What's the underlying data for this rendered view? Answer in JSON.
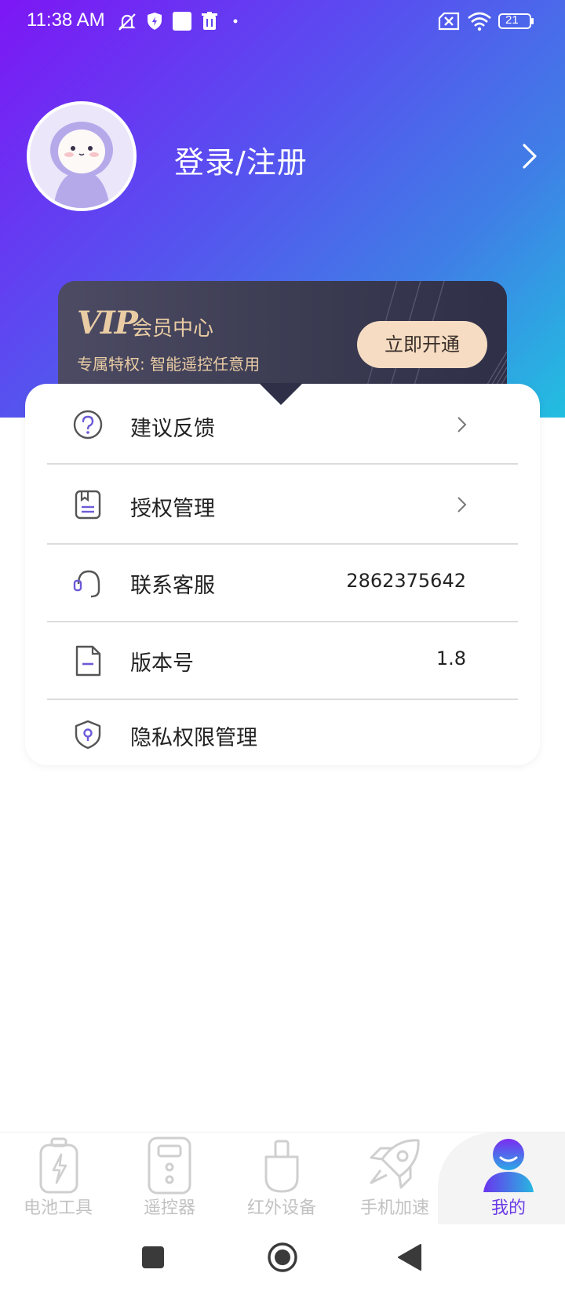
{
  "status_bar": {
    "time": "11:38 AM",
    "battery_level": "21"
  },
  "profile": {
    "login_label": "登录/注册"
  },
  "vip": {
    "logo": "VIP",
    "title": "会员中心",
    "subtitle": "专属特权: 智能遥控任意用",
    "button_label": "立即开通"
  },
  "menu": {
    "items": [
      {
        "label": "建议反馈",
        "icon": "question-icon",
        "value": "",
        "has_chevron": true
      },
      {
        "label": "授权管理",
        "icon": "document-bookmark-icon",
        "value": "",
        "has_chevron": true
      },
      {
        "label": "联系客服",
        "icon": "headset-icon",
        "value": "2862375642",
        "has_chevron": false
      },
      {
        "label": "版本号",
        "icon": "file-icon",
        "value": "1.8",
        "has_chevron": false
      },
      {
        "label": "隐私权限管理",
        "icon": "location-shield-icon",
        "value": "",
        "has_chevron": false
      }
    ]
  },
  "tabbar": {
    "items": [
      {
        "label": "电池工具",
        "icon": "battery-bolt-icon",
        "active": false
      },
      {
        "label": "遥控器",
        "icon": "remote-control-icon",
        "active": false
      },
      {
        "label": "红外设备",
        "icon": "usb-device-icon",
        "active": false
      },
      {
        "label": "手机加速",
        "icon": "rocket-icon",
        "active": false
      },
      {
        "label": "我的",
        "icon": "user-icon",
        "active": true
      }
    ]
  },
  "colors": {
    "gradient_start": "#7d16f5",
    "gradient_end": "#22bfe0",
    "vip_gold": "#e9cca4",
    "active_tab": "#6b3be6"
  }
}
